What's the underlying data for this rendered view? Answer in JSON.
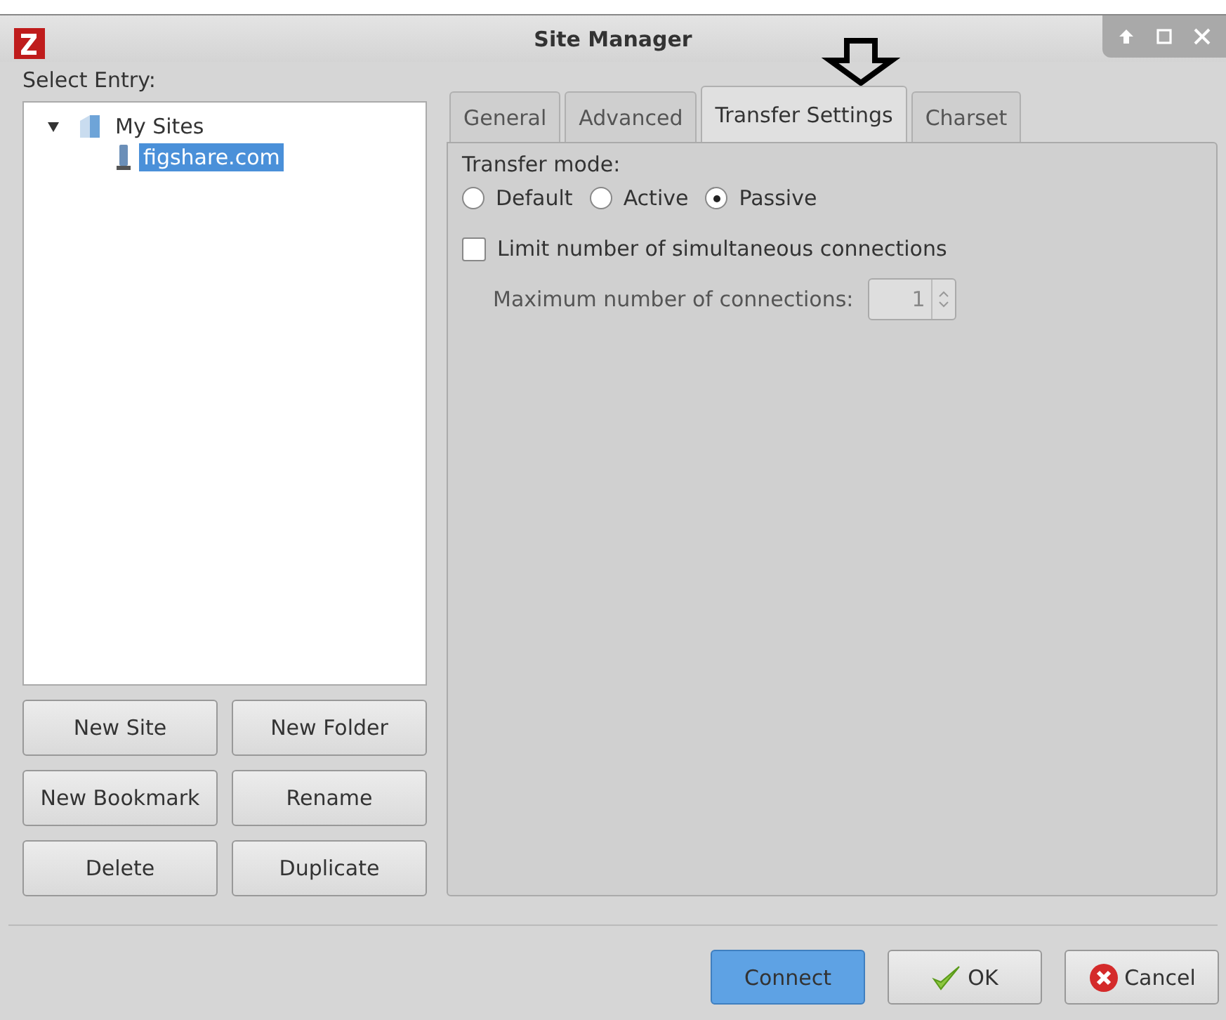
{
  "window": {
    "title": "Site Manager"
  },
  "select_entry_label": "Select Entry:",
  "tree": [
    {
      "label": "My Sites",
      "expanded": true,
      "selected": false,
      "children": [
        {
          "label": "figshare.com",
          "selected": true
        }
      ]
    }
  ],
  "site_buttons": [
    "New Site",
    "New Folder",
    "New Bookmark",
    "Rename",
    "Delete",
    "Duplicate"
  ],
  "tabs": [
    {
      "label": "General",
      "selected": false
    },
    {
      "label": "Advanced",
      "selected": false
    },
    {
      "label": "Transfer Settings",
      "selected": true
    },
    {
      "label": "Charset",
      "selected": false
    }
  ],
  "transfer_mode": {
    "label": "Transfer mode:",
    "options": [
      {
        "label": "Default",
        "selected": false
      },
      {
        "label": "Active",
        "selected": false
      },
      {
        "label": "Passive",
        "selected": true
      }
    ]
  },
  "limit_connections": {
    "label": "Limit number of simultaneous connections",
    "checked": false
  },
  "max_connections": {
    "label": "Maximum number of connections:",
    "value": "1",
    "disabled": true
  },
  "dialog_buttons": [
    {
      "label": "Connect",
      "kind": "default"
    },
    {
      "label": "OK",
      "kind": "ok"
    },
    {
      "label": "Cancel",
      "kind": "cancel"
    }
  ]
}
